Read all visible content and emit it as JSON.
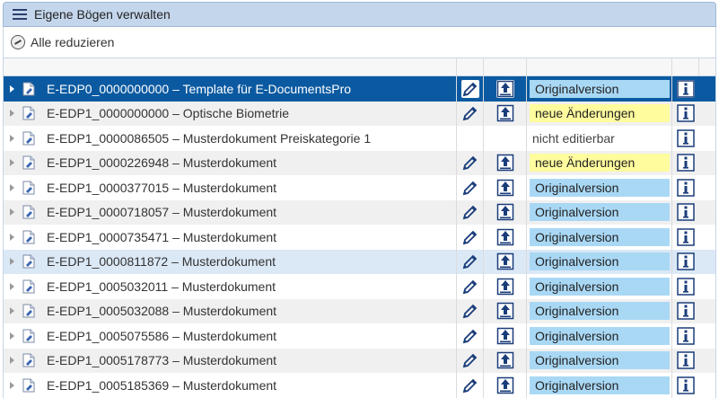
{
  "header": {
    "title": "Eigene Bögen verwalten",
    "menu_icon": "hamburger-menu-icon"
  },
  "toolbar": {
    "collapse_label": "Alle reduzieren",
    "collapse_icon": "collapse-all-icon"
  },
  "colors": {
    "header_bg": "#c4d6ec",
    "selected_row": "#0b5aa1",
    "original_badge": "#a9d8f5",
    "changes_badge": "#fffc9e",
    "hover_row": "#dbe8f6"
  },
  "rows": [
    {
      "name": "E-EDP0_0000000000 – Template für E-DocumentsPro",
      "status": "Originalversion",
      "status_type": "original",
      "editable": true,
      "selected": true
    },
    {
      "name": "E-EDP1_0000000000 – Optische Biometrie",
      "status": "neue Änderungen",
      "status_type": "changes",
      "editable": true
    },
    {
      "name": "E-EDP1_0000086505 – Musterdokument Preiskategorie 1",
      "status": "nicht editierbar",
      "status_type": "plain",
      "editable": false
    },
    {
      "name": "E-EDP1_0000226948 – Musterdokument",
      "status": "neue Änderungen",
      "status_type": "changes",
      "editable": true
    },
    {
      "name": "E-EDP1_0000377015 – Musterdokument",
      "status": "Originalversion",
      "status_type": "original",
      "editable": true
    },
    {
      "name": "E-EDP1_0000718057 – Musterdokument",
      "status": "Originalversion",
      "status_type": "original",
      "editable": true
    },
    {
      "name": "E-EDP1_0000735471 – Musterdokument",
      "status": "Originalversion",
      "status_type": "original",
      "editable": true
    },
    {
      "name": "E-EDP1_0000811872 – Musterdokument",
      "status": "Originalversion",
      "status_type": "original",
      "editable": true,
      "hover": true
    },
    {
      "name": "E-EDP1_0005032011 – Musterdokument",
      "status": "Originalversion",
      "status_type": "original",
      "editable": true
    },
    {
      "name": "E-EDP1_0005032088 – Musterdokument",
      "status": "Originalversion",
      "status_type": "original",
      "editable": true
    },
    {
      "name": "E-EDP1_0005075586 – Musterdokument",
      "status": "Originalversion",
      "status_type": "original",
      "editable": true
    },
    {
      "name": "E-EDP1_0005178773 – Musterdokument",
      "status": "Originalversion",
      "status_type": "original",
      "editable": true
    },
    {
      "name": "E-EDP1_0005185369 – Musterdokument",
      "status": "Originalversion",
      "status_type": "original",
      "editable": true
    }
  ]
}
